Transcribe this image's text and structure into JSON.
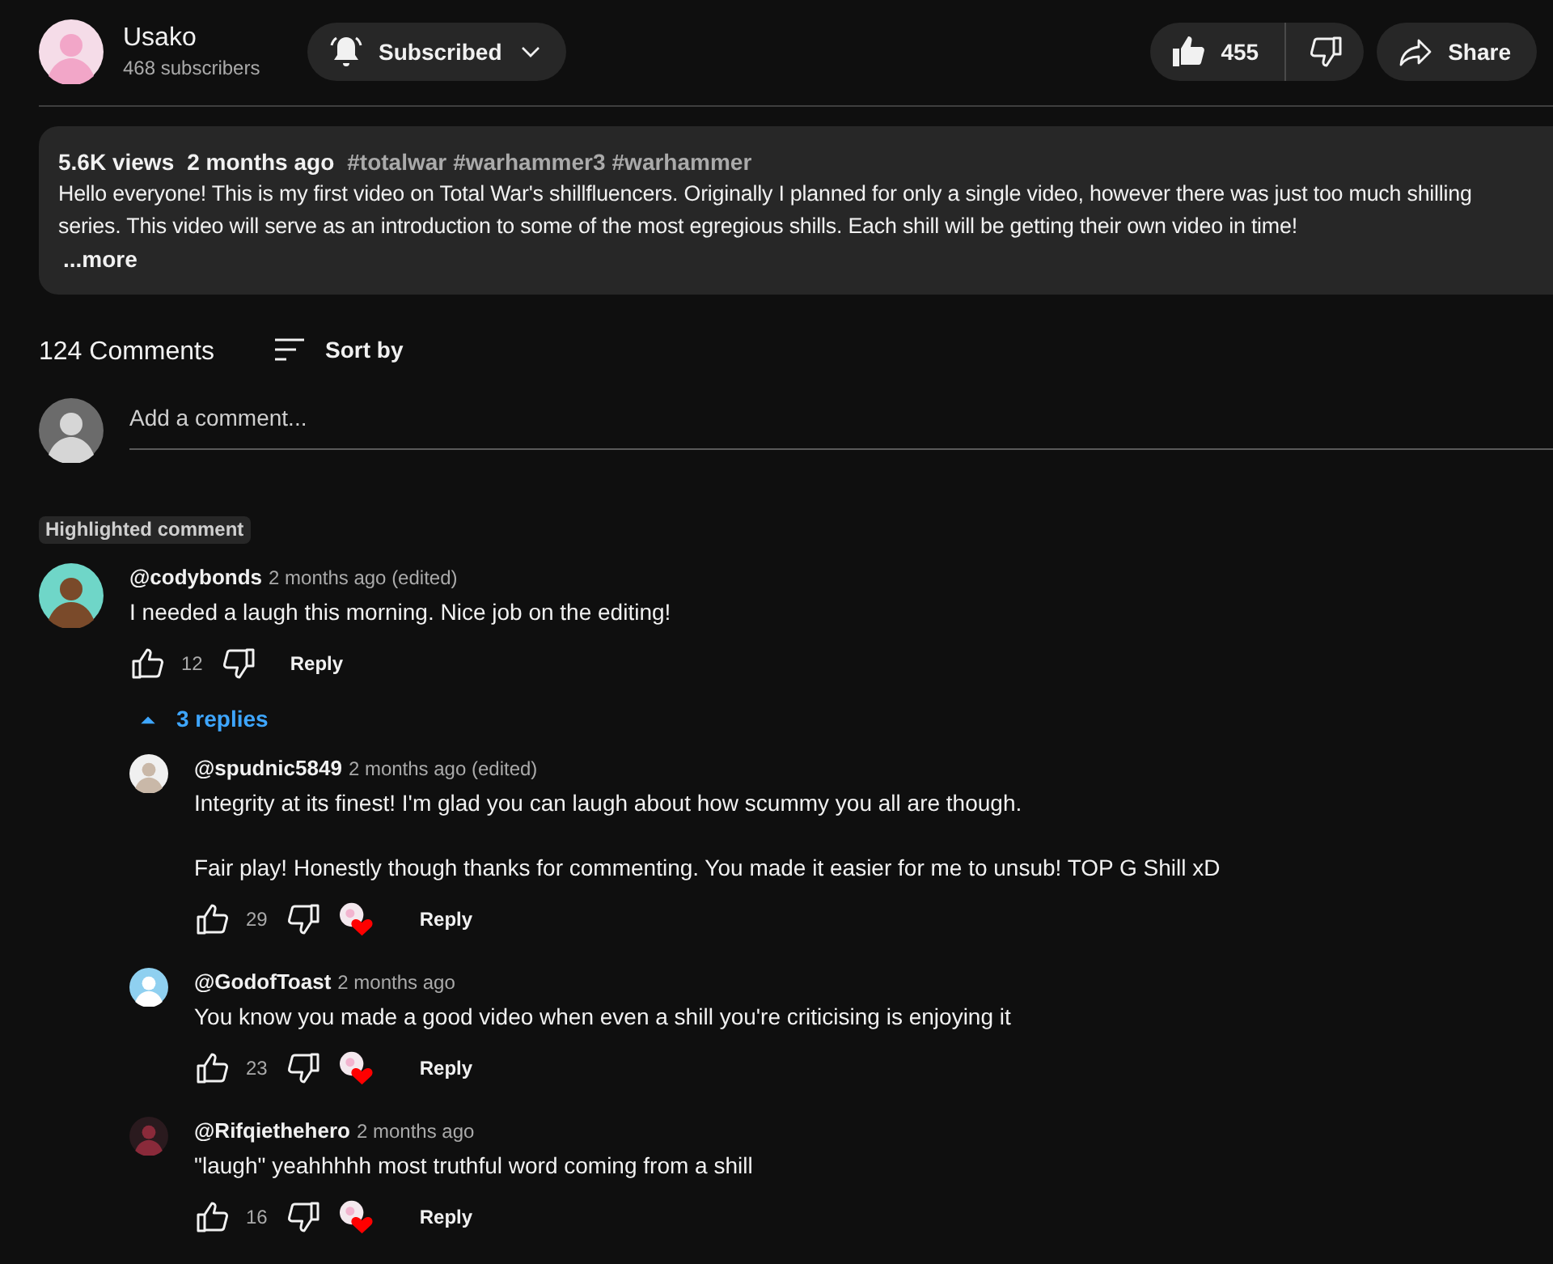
{
  "channel": {
    "name": "Usako",
    "subscribers": "468 subscribers"
  },
  "subscribe_button": {
    "label": "Subscribed"
  },
  "like_button": {
    "count": "455",
    "liked": true
  },
  "share_button": {
    "label": "Share"
  },
  "description": {
    "views": "5.6K views",
    "date": "2 months ago",
    "tags": [
      "#totalwar",
      "#warhammer3",
      "#warhammer"
    ],
    "lines": [
      "Hello everyone! This is my first video on Total War's shillfluencers. Originally I planned for only a single video, however there was just too much shilling",
      "series. This video will serve as an introduction to some of the most egregious shills. Each shill will be getting their own video in time!"
    ],
    "more": "...more"
  },
  "comments_header": {
    "count": "124 Comments",
    "sort": "Sort by"
  },
  "add_comment": {
    "placeholder": "Add a comment..."
  },
  "highlighted_label": "Highlighted comment",
  "comment": {
    "author": "@codybonds",
    "time": "2 months ago (edited)",
    "paragraphs": [
      "I needed a laugh this morning. Nice job on the editing!"
    ],
    "likes": "12",
    "hearted": false,
    "reply": "Reply"
  },
  "replies_toggle": {
    "label": "3 replies",
    "expanded": true
  },
  "replies": [
    {
      "author": "@spudnic5849",
      "time": "2 months ago (edited)",
      "paragraphs": [
        "Integrity at its finest! I'm glad you can laugh about how scummy you all are though.",
        "Fair play! Honestly though thanks for commenting. You made it easier for me to unsub! TOP G Shill xD"
      ],
      "likes": "29",
      "hearted": true,
      "reply": "Reply"
    },
    {
      "author": "@GodofToast",
      "time": "2 months ago",
      "paragraphs": [
        "You know you made a good video when even a shill you're criticising is enjoying it"
      ],
      "likes": "23",
      "hearted": true,
      "reply": "Reply"
    },
    {
      "author": "@Rifqiethehero",
      "time": "2 months ago",
      "paragraphs": [
        "\"laugh\" yeahhhhh most truthful word coming from a shill"
      ],
      "likes": "16",
      "hearted": true,
      "reply": "Reply"
    }
  ]
}
